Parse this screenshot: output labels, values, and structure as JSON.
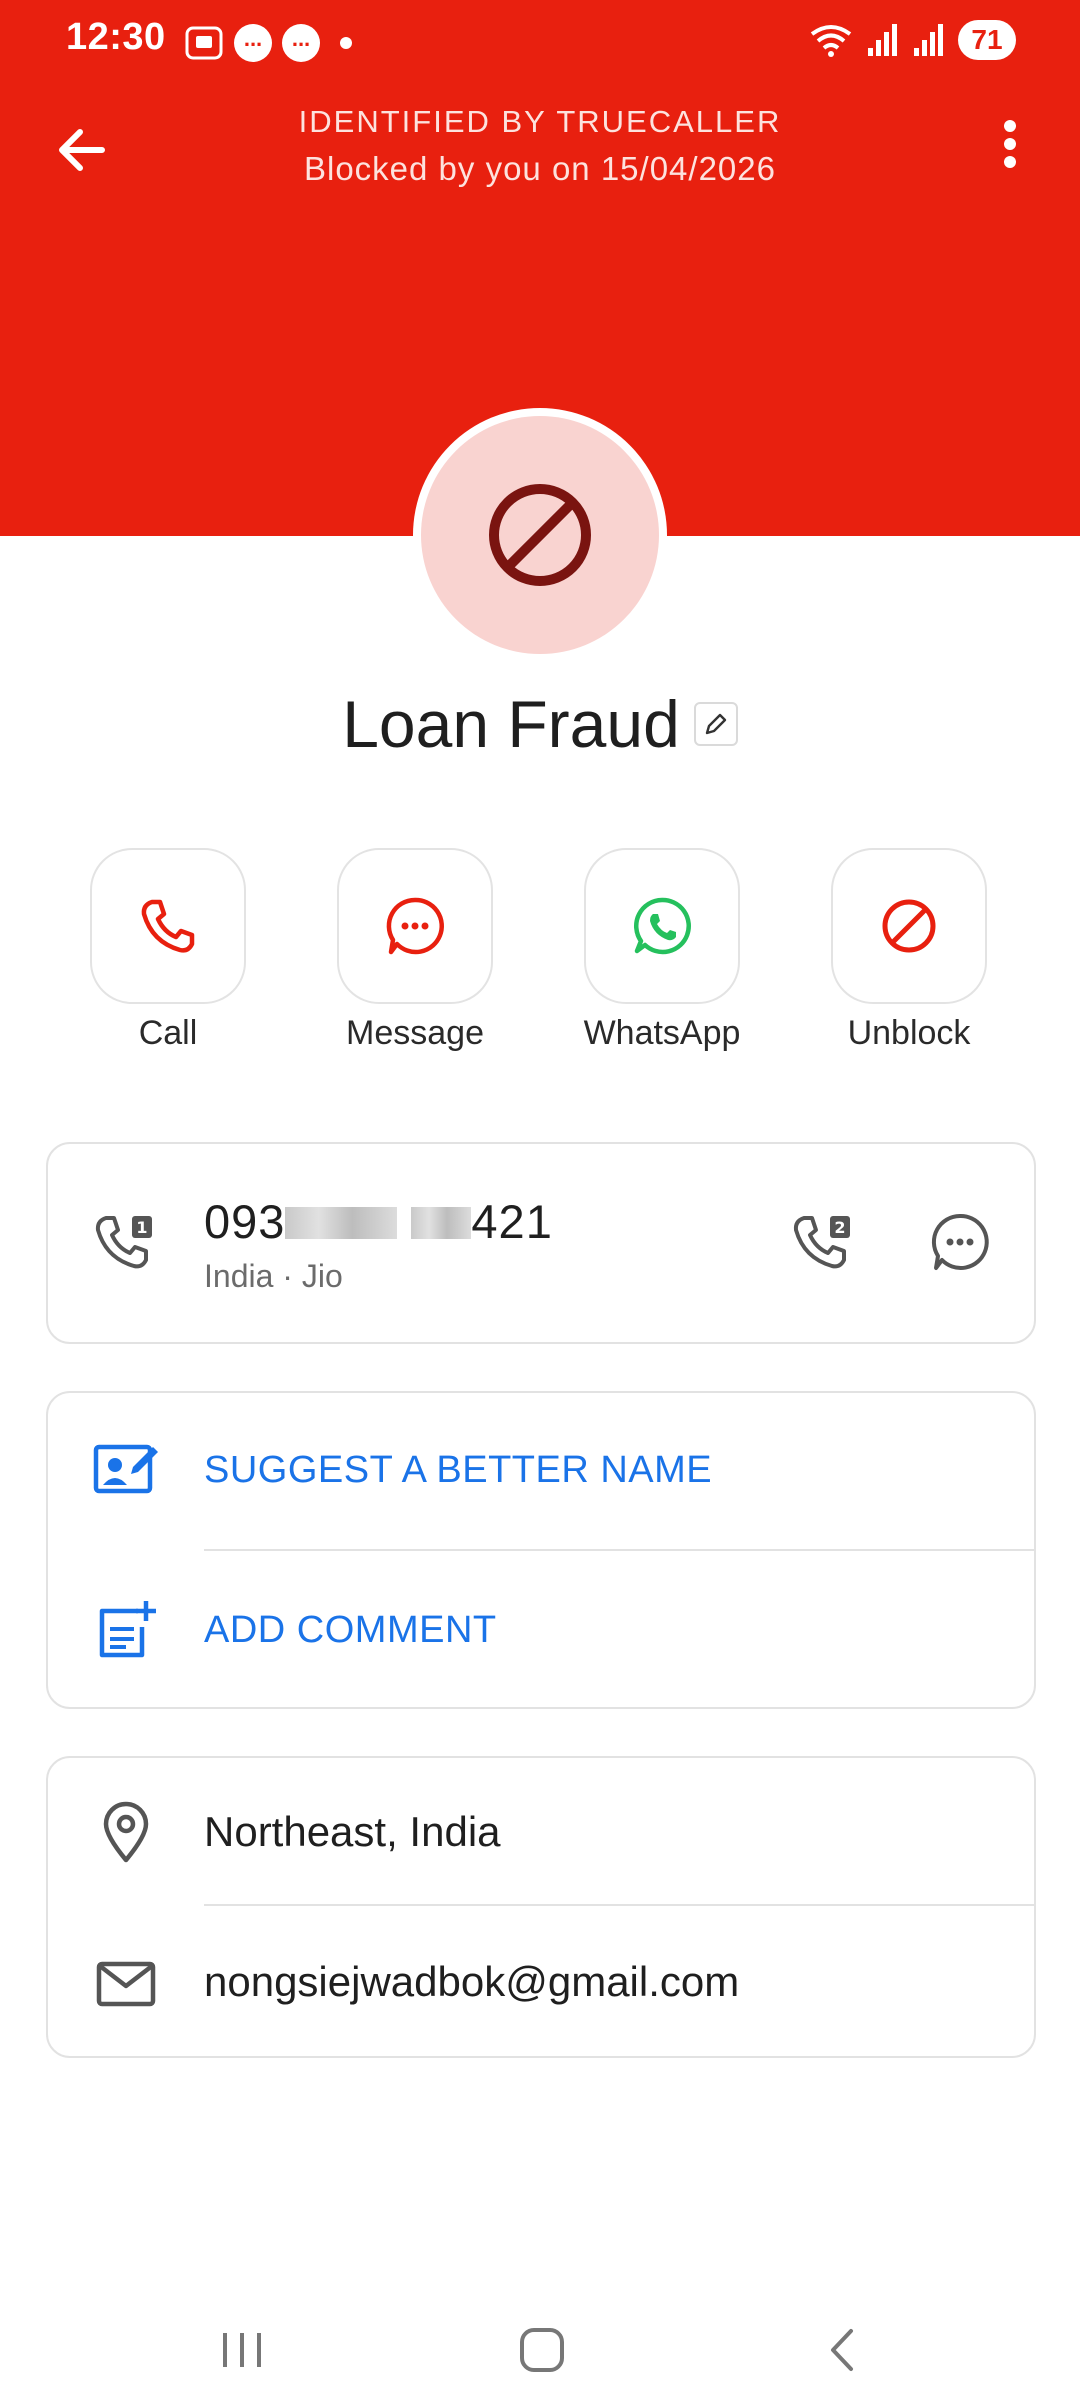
{
  "status_bar": {
    "time": "12:30",
    "battery": "71"
  },
  "header": {
    "identified_label": "IDENTIFIED BY TRUECALLER",
    "blocked_label": "Blocked by you on 15/04/2026",
    "color": "#e8200f"
  },
  "contact": {
    "name": "Loan Fraud"
  },
  "actions": [
    {
      "label": "Call",
      "icon": "phone-icon"
    },
    {
      "label": "Message",
      "icon": "message-icon"
    },
    {
      "label": "WhatsApp",
      "icon": "whatsapp-icon"
    },
    {
      "label": "Unblock",
      "icon": "block-icon"
    }
  ],
  "phone": {
    "prefix": "093",
    "suffix": "421",
    "details": "India · Jio"
  },
  "suggest": {
    "suggest_label": "SUGGEST A BETTER NAME",
    "comment_label": "ADD COMMENT"
  },
  "info": {
    "location": "Northeast, India",
    "email": "nongsiejwadbok@gmail.com"
  },
  "colors": {
    "accent_red": "#e8200f",
    "link_blue": "#1a73e8",
    "whatsapp_green": "#25c05d"
  }
}
